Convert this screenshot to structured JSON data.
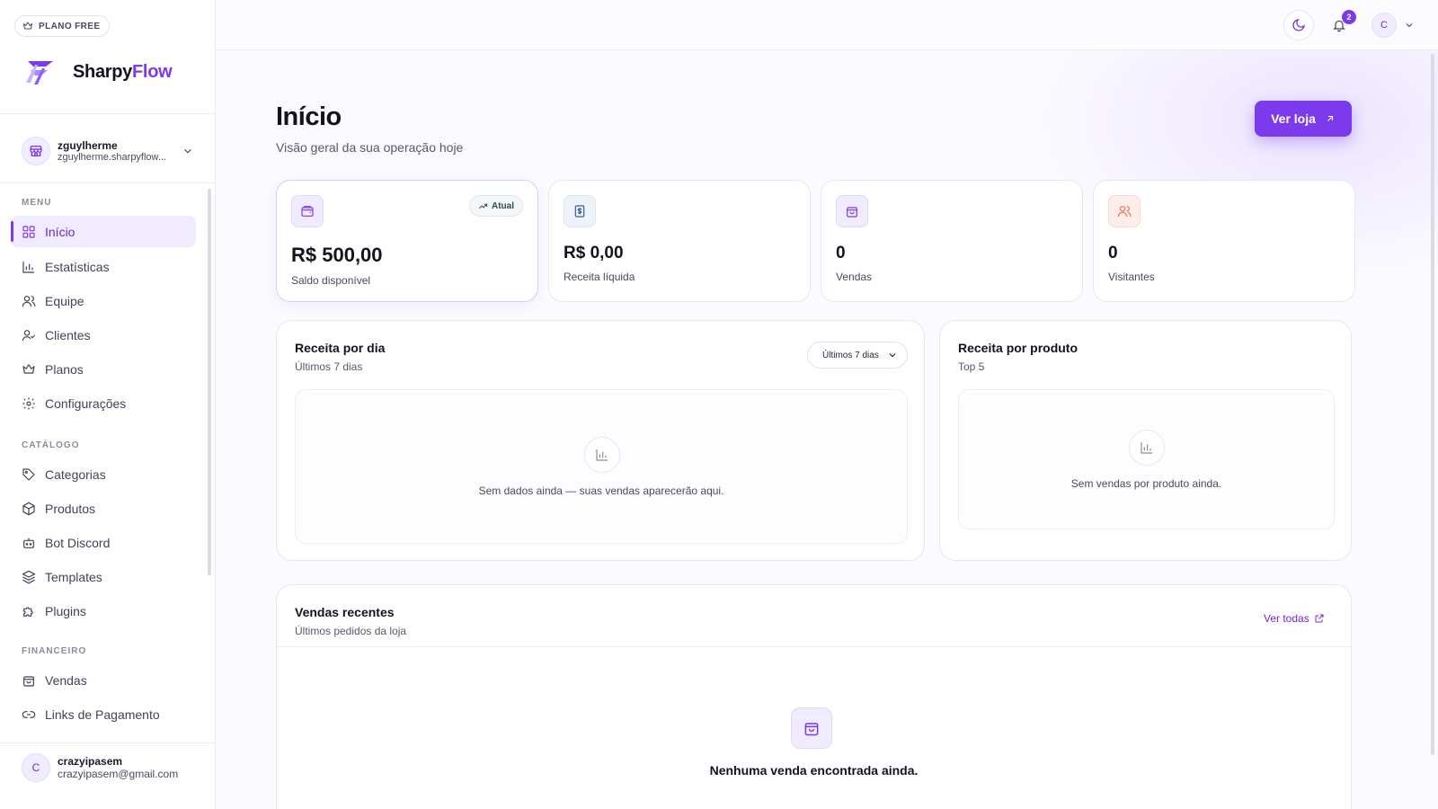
{
  "sidebar": {
    "plan_badge": "PLANO FREE",
    "logo": {
      "part1": "Sharpy",
      "part2": "Flow"
    },
    "store": {
      "name": "zguylherme",
      "url": "zguylherme.sharpyflow..."
    },
    "sections": {
      "menu": "MENU",
      "catalog": "CATÁLOGO",
      "finance": "FINANCEIRO"
    },
    "menu_items": [
      {
        "label": "Início",
        "icon": "grid-icon"
      },
      {
        "label": "Estatísticas",
        "icon": "bar-chart-icon"
      },
      {
        "label": "Equipe",
        "icon": "users-icon"
      },
      {
        "label": "Clientes",
        "icon": "user-check-icon"
      },
      {
        "label": "Planos",
        "icon": "crown-icon"
      },
      {
        "label": "Configurações",
        "icon": "gear-icon"
      }
    ],
    "catalog_items": [
      {
        "label": "Categorias",
        "icon": "tag-icon"
      },
      {
        "label": "Produtos",
        "icon": "package-icon"
      },
      {
        "label": "Bot Discord",
        "icon": "bot-icon"
      },
      {
        "label": "Templates",
        "icon": "layers-icon"
      },
      {
        "label": "Plugins",
        "icon": "puzzle-icon"
      }
    ],
    "finance_items": [
      {
        "label": "Vendas",
        "icon": "shopping-bag-icon"
      },
      {
        "label": "Links de Pagamento",
        "icon": "link-icon"
      }
    ],
    "user": {
      "initial": "C",
      "name": "crazyipasem",
      "email": "crazyipasem@gmail.com"
    }
  },
  "topbar": {
    "notification_count": "2",
    "avatar_initial": "C"
  },
  "header": {
    "title": "Início",
    "subtitle": "Visão geral da sua operação hoje",
    "store_button": "Ver loja"
  },
  "stats": [
    {
      "value": "R$ 500,00",
      "label": "Saldo disponível",
      "badge": "Atual",
      "icon": "wallet-icon"
    },
    {
      "value": "R$ 0,00",
      "label": "Receita líquida",
      "icon": "receipt-icon"
    },
    {
      "value": "0",
      "label": "Vendas",
      "icon": "shopping-bag-icon"
    },
    {
      "value": "0",
      "label": "Visitantes",
      "icon": "users-icon"
    }
  ],
  "revenue_day": {
    "title": "Receita por dia",
    "subtitle": "Últimos 7 dias",
    "select": "Últimos 7 dias",
    "empty": "Sem dados ainda — suas vendas aparecerão aqui."
  },
  "revenue_product": {
    "title": "Receita por produto",
    "subtitle": "Top 5",
    "empty": "Sem vendas por produto ainda."
  },
  "recent_sales": {
    "title": "Vendas recentes",
    "subtitle": "Últimos pedidos da loja",
    "see_all": "Ver todas",
    "empty": "Nenhuma venda encontrada ainda."
  },
  "colors": {
    "accent": "#7c3aed",
    "accent_soft": "#f1ebff",
    "text": "#15121f",
    "border": "#e8e5f0"
  }
}
